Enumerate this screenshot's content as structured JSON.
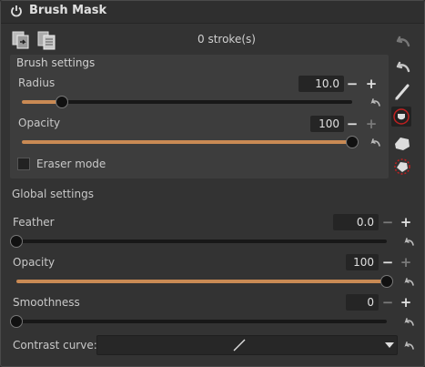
{
  "header": {
    "title": "Brush Mask",
    "power_icon": "power-icon"
  },
  "toolbar": {
    "strokes_text": "0 stroke(s)",
    "copy_icon": "copy-mask-icon",
    "paste_icon": "paste-mask-icon"
  },
  "brush": {
    "title": "Brush settings",
    "radius": {
      "label": "Radius",
      "value": "10.0",
      "fraction": 0.12
    },
    "opacity": {
      "label": "Opacity",
      "value": "100",
      "fraction": 1.0
    },
    "eraser": {
      "label": "Eraser mode",
      "checked": false
    }
  },
  "global": {
    "title": "Global settings",
    "feather": {
      "label": "Feather",
      "value": "0.0",
      "fraction": 0.0
    },
    "opacity": {
      "label": "Opacity",
      "value": "100",
      "fraction": 1.0
    },
    "smoothness": {
      "label": "Smoothness",
      "value": "0",
      "fraction": 0.0
    },
    "contrast": {
      "label": "Contrast curve:"
    }
  },
  "sidebar": {
    "tools": [
      "undo-icon",
      "redo-icon",
      "brush-icon",
      "draw-brush-icon",
      "fill-icon",
      "clear-all-icon"
    ]
  },
  "colors": {
    "accent": "#c98a54",
    "panel": "#3d3d3d",
    "background": "#333333"
  }
}
